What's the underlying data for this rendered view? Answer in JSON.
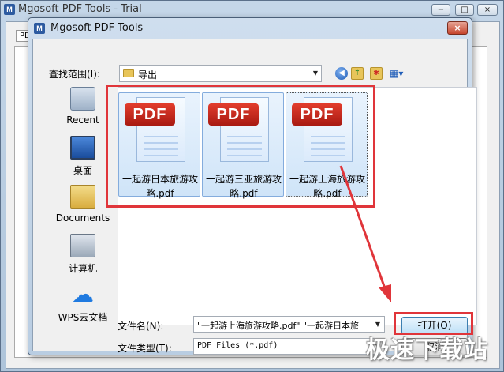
{
  "main_window": {
    "title": "Mgosoft PDF Tools - Trial",
    "tab_label": "PD",
    "logo_text": "M",
    "minimize": "−",
    "maximize": "□",
    "close": "×"
  },
  "dialog": {
    "title": "Mgosoft PDF Tools",
    "close": "×",
    "look_in_label": "查找范围(I):",
    "look_in_value": "导出",
    "toolbar": {
      "back_icon": "back-arrow-icon",
      "up_icon": "up-folder-icon",
      "new_icon": "new-folder-icon",
      "view_icon": "view-menu-icon"
    },
    "places": [
      {
        "label": "Recent",
        "icon": "recent-places-icon"
      },
      {
        "label": "桌面",
        "icon": "desktop-icon"
      },
      {
        "label": "Documents",
        "icon": "documents-icon"
      },
      {
        "label": "计算机",
        "icon": "computer-icon"
      },
      {
        "label": "WPS云文档",
        "icon": "cloud-icon"
      }
    ],
    "files": [
      {
        "badge": "PDF",
        "name_line1": "一起游日本旅游攻",
        "name_line2": "略.pdf"
      },
      {
        "badge": "PDF",
        "name_line1": "一起游三亚旅游攻",
        "name_line2": "略.pdf"
      },
      {
        "badge": "PDF",
        "name_line1": "一起游上海旅游攻",
        "name_line2": "略.pdf"
      }
    ],
    "file_name_label": "文件名(N):",
    "file_name_value": "\"一起游上海旅游攻略.pdf\" \"一起游日本旅",
    "file_type_label": "文件类型(T):",
    "file_type_value": "PDF Files (*.pdf)",
    "open_button": "打开(O)",
    "cancel_button": "取消"
  },
  "watermark": "极速下载站",
  "colors": {
    "highlight": "#e0353a",
    "pdf_badge": "#c8251a",
    "selection": "#cfe4f8"
  }
}
